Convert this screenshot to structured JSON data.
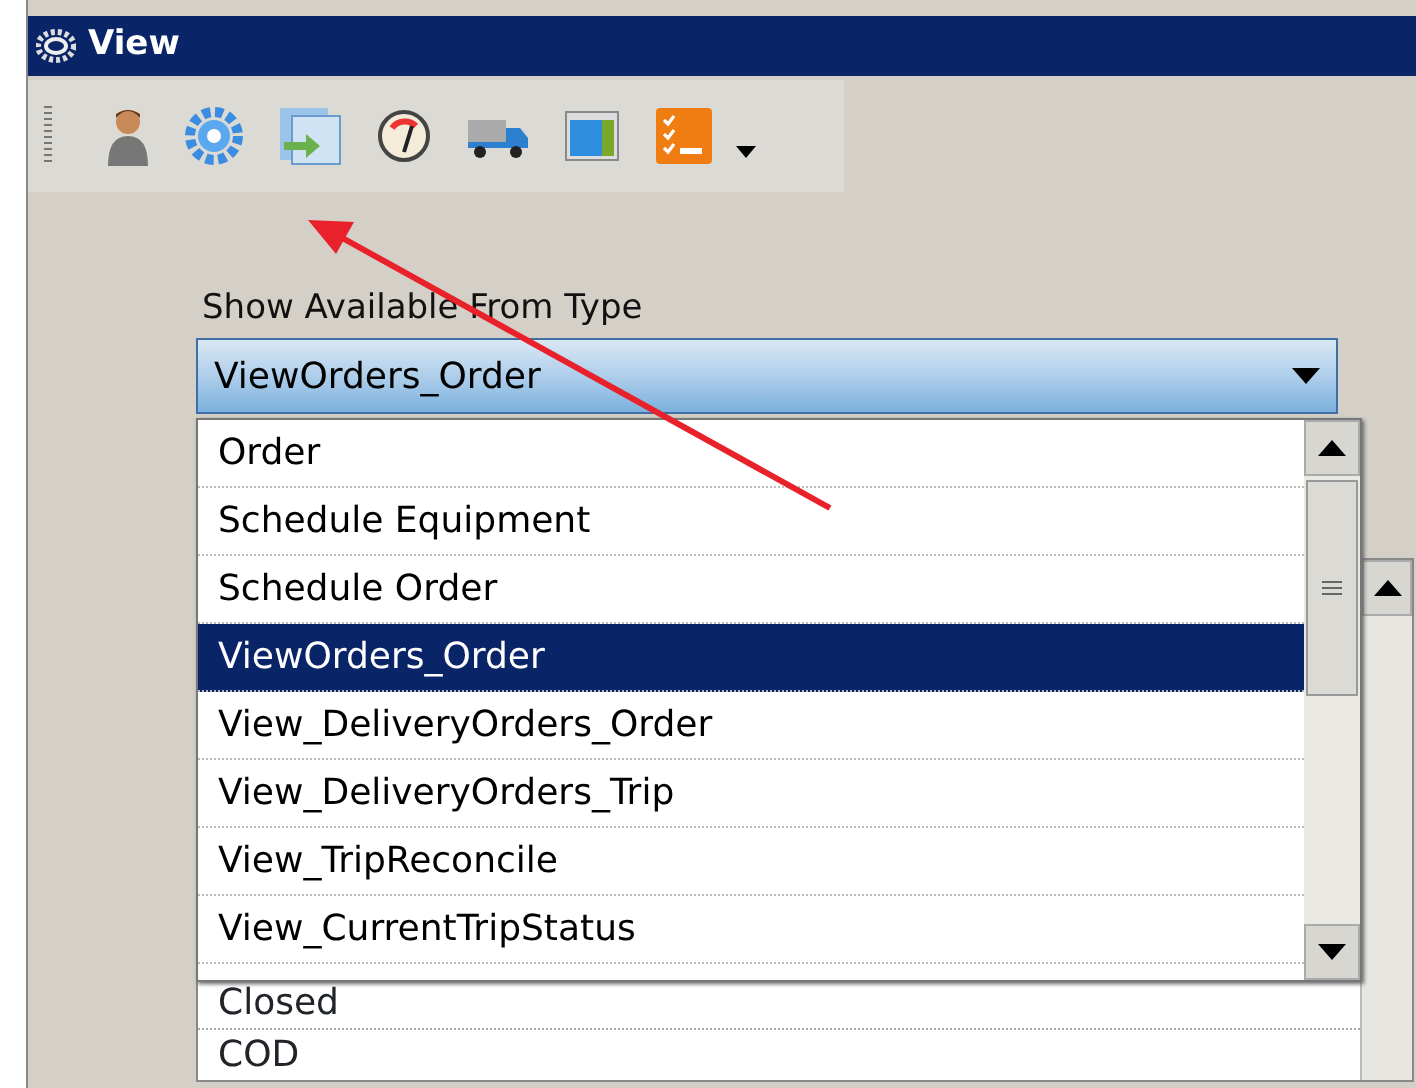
{
  "window": {
    "title": "View"
  },
  "filter": {
    "label": "Show Available From Type",
    "value": "ViewOrders_Order",
    "expanded": true
  },
  "dropdown": {
    "options": [
      {
        "label": "Order",
        "selected": false
      },
      {
        "label": "Schedule Equipment",
        "selected": false
      },
      {
        "label": "Schedule Order",
        "selected": false
      },
      {
        "label": "ViewOrders_Order",
        "selected": true
      },
      {
        "label": "View_DeliveryOrders_Order",
        "selected": false
      },
      {
        "label": "View_DeliveryOrders_Trip",
        "selected": false
      },
      {
        "label": "View_TripReconcile",
        "selected": false
      },
      {
        "label": "View_CurrentTripStatus",
        "selected": false
      }
    ]
  },
  "list": {
    "items": [
      "Closed",
      "COD"
    ]
  }
}
